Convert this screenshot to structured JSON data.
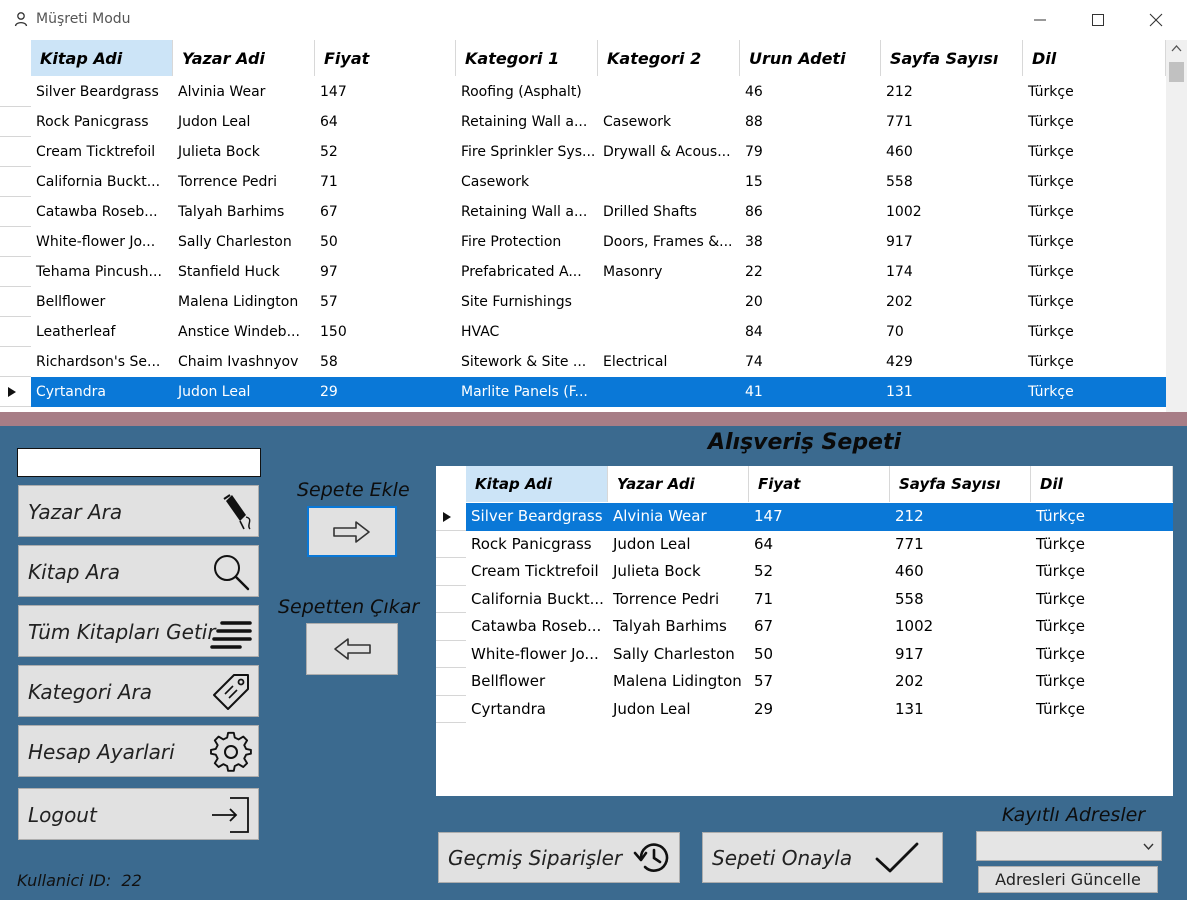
{
  "window": {
    "title": "Müşreti Modu"
  },
  "books_grid": {
    "columns": [
      "Kitap Adi",
      "Yazar Adi",
      "Fiyat",
      "Kategori 1",
      "Kategori 2",
      "Urun Adeti",
      "Sayfa Sayısı",
      "Dil"
    ],
    "rows": [
      [
        "Silver Beardgrass",
        "Alvinia Wear",
        "147",
        "Roofing (Asphalt)",
        "",
        "46",
        "212",
        "Türkçe"
      ],
      [
        "Rock Panicgrass",
        "Judon Leal",
        "64",
        "Retaining Wall a...",
        "Casework",
        "88",
        "771",
        "Türkçe"
      ],
      [
        "Cream Ticktrefoil",
        "Julieta Bock",
        "52",
        "Fire Sprinkler Sys...",
        "Drywall & Acous...",
        "79",
        "460",
        "Türkçe"
      ],
      [
        "California Buckt...",
        "Torrence Pedri",
        "71",
        "Casework",
        "",
        "15",
        "558",
        "Türkçe"
      ],
      [
        "Catawba Roseb...",
        "Talyah Barhims",
        "67",
        "Retaining Wall a...",
        "Drilled Shafts",
        "86",
        "1002",
        "Türkçe"
      ],
      [
        "White-flower Jo...",
        "Sally Charleston",
        "50",
        "Fire Protection",
        "Doors, Frames &...",
        "38",
        "917",
        "Türkçe"
      ],
      [
        "Tehama Pincush...",
        "Stanfield Huck",
        "97",
        "Prefabricated A...",
        "Masonry",
        "22",
        "174",
        "Türkçe"
      ],
      [
        "Bellflower",
        "Malena Lidington",
        "57",
        "Site Furnishings",
        "",
        "20",
        "202",
        "Türkçe"
      ],
      [
        "Leatherleaf",
        "Anstice Windeb...",
        "150",
        "HVAC",
        "",
        "84",
        "70",
        "Türkçe"
      ],
      [
        "Richardson's Se...",
        "Chaim Ivashnyov",
        "58",
        "Sitework & Site ...",
        "Electrical",
        "74",
        "429",
        "Türkçe"
      ],
      [
        "Cyrtandra",
        "Judon Leal",
        "29",
        "Marlite Panels (F...",
        "",
        "41",
        "131",
        "Türkçe"
      ]
    ]
  },
  "sidebar": {
    "search_value": "",
    "buttons": [
      {
        "label": "Yazar Ara",
        "icon": "pen-icon"
      },
      {
        "label": "Kitap Ara",
        "icon": "search-icon"
      },
      {
        "label": "Tüm Kitapları Getir",
        "icon": "list-lines-icon"
      },
      {
        "label": "Kategori Ara",
        "icon": "tag-icon"
      },
      {
        "label": "Hesap Ayarlari",
        "icon": "gear-icon"
      },
      {
        "label": "Logout",
        "icon": "logout-icon"
      }
    ],
    "user_id_label": "Kullanici ID:",
    "user_id": "22"
  },
  "cart_actions": {
    "add_label": "Sepete Ekle",
    "remove_label": "Sepetten Çıkar"
  },
  "cart": {
    "title": "Alışveriş Sepeti",
    "columns": [
      "Kitap Adi",
      "Yazar Adi",
      "Fiyat",
      "Sayfa Sayısı",
      "Dil"
    ],
    "rows": [
      [
        "Silver Beardgrass",
        "Alvinia Wear",
        "147",
        "212",
        "Türkçe"
      ],
      [
        "Rock Panicgrass",
        "Judon Leal",
        "64",
        "771",
        "Türkçe"
      ],
      [
        "Cream Ticktrefoil",
        "Julieta Bock",
        "52",
        "460",
        "Türkçe"
      ],
      [
        "California Buckt...",
        "Torrence Pedri",
        "71",
        "558",
        "Türkçe"
      ],
      [
        "Catawba Roseb...",
        "Talyah Barhims",
        "67",
        "1002",
        "Türkçe"
      ],
      [
        "White-flower Jo...",
        "Sally Charleston",
        "50",
        "917",
        "Türkçe"
      ],
      [
        "Bellflower",
        "Malena Lidington",
        "57",
        "202",
        "Türkçe"
      ],
      [
        "Cyrtandra",
        "Judon Leal",
        "29",
        "131",
        "Türkçe"
      ]
    ]
  },
  "footer": {
    "history_label": "Geçmiş Siparişler",
    "confirm_label": "Sepeti Onayla",
    "address_label": "Kayıtlı Adresler",
    "address_selected": "",
    "address_update_label": "Adresleri Güncelle"
  },
  "colors": {
    "panel_bg": "#3b6a8f",
    "divider": "#a77d86",
    "selection": "#0a78d7",
    "header_highlight": "#cce4f7",
    "button_bg": "#e1e1e1"
  }
}
